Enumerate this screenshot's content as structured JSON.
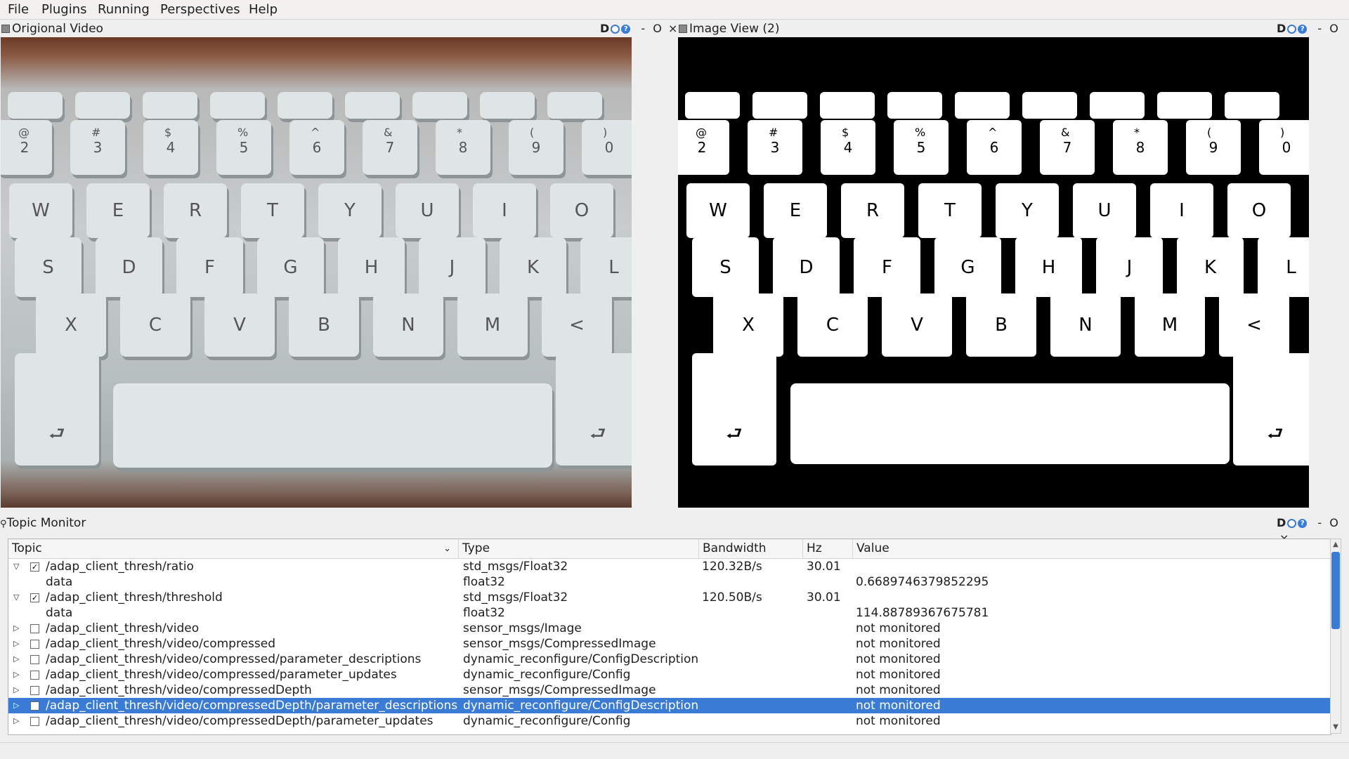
{
  "menubar": {
    "items": [
      {
        "label": "File"
      },
      {
        "label": "Plugins"
      },
      {
        "label": "Running"
      },
      {
        "label": "Perspectives"
      },
      {
        "label": "Help"
      }
    ]
  },
  "docks": {
    "original": {
      "title": "Origional Video"
    },
    "image_view": {
      "title": "Image View (2)"
    },
    "topic_monitor": {
      "title": "Topic Monitor"
    },
    "buttons": {
      "d": "D",
      "minimize": "-",
      "float": "O",
      "close": "×"
    }
  },
  "keyboard": {
    "fn_row": [
      "",
      "",
      "",
      "",
      "",
      "",
      "",
      "",
      ""
    ],
    "num_row": [
      "2",
      "3",
      "4",
      "5",
      "6",
      "7",
      "8",
      "9",
      "0"
    ],
    "num_shift": [
      "@",
      "#",
      "$",
      "%",
      "^",
      "&",
      "*",
      "(",
      ")"
    ],
    "row_q": [
      "W",
      "E",
      "R",
      "T",
      "Y",
      "U",
      "I",
      "O"
    ],
    "row_a": [
      "S",
      "D",
      "F",
      "G",
      "H",
      "J",
      "K",
      "L"
    ],
    "row_z": [
      "X",
      "C",
      "V",
      "B",
      "N",
      "M",
      "<"
    ],
    "return_glyph": "⮐"
  },
  "topic_monitor": {
    "columns": [
      "Topic",
      "Type",
      "Bandwidth",
      "Hz",
      "Value"
    ],
    "rows": [
      {
        "expanded": true,
        "checked": true,
        "topic": "/adap_client_thresh/ratio",
        "type": "std_msgs/Float32",
        "bandwidth": "120.32B/s",
        "hz": "30.01",
        "value": ""
      },
      {
        "child": true,
        "topic": "data",
        "type": "float32",
        "bandwidth": "",
        "hz": "",
        "value": "0.6689746379852295"
      },
      {
        "expanded": true,
        "checked": true,
        "topic": "/adap_client_thresh/threshold",
        "type": "std_msgs/Float32",
        "bandwidth": "120.50B/s",
        "hz": "30.01",
        "value": ""
      },
      {
        "child": true,
        "topic": "data",
        "type": "float32",
        "bandwidth": "",
        "hz": "",
        "value": "114.88789367675781"
      },
      {
        "expanded": false,
        "checked": false,
        "topic": "/adap_client_thresh/video",
        "type": "sensor_msgs/Image",
        "bandwidth": "",
        "hz": "",
        "value": "not monitored"
      },
      {
        "expanded": false,
        "checked": false,
        "topic": "/adap_client_thresh/video/compressed",
        "type": "sensor_msgs/CompressedImage",
        "bandwidth": "",
        "hz": "",
        "value": "not monitored"
      },
      {
        "expanded": false,
        "checked": false,
        "topic": "/adap_client_thresh/video/compressed/parameter_descriptions",
        "type": "dynamic_reconfigure/ConfigDescription",
        "bandwidth": "",
        "hz": "",
        "value": "not monitored"
      },
      {
        "expanded": false,
        "checked": false,
        "topic": "/adap_client_thresh/video/compressed/parameter_updates",
        "type": "dynamic_reconfigure/Config",
        "bandwidth": "",
        "hz": "",
        "value": "not monitored"
      },
      {
        "expanded": false,
        "checked": false,
        "topic": "/adap_client_thresh/video/compressedDepth",
        "type": "sensor_msgs/CompressedImage",
        "bandwidth": "",
        "hz": "",
        "value": "not monitored"
      },
      {
        "expanded": false,
        "checked": false,
        "selected": true,
        "topic": "/adap_client_thresh/video/compressedDepth/parameter_descriptions",
        "type": "dynamic_reconfigure/ConfigDescription",
        "bandwidth": "",
        "hz": "",
        "value": "not monitored"
      },
      {
        "expanded": false,
        "checked": false,
        "topic": "/adap_client_thresh/video/compressedDepth/parameter_updates",
        "type": "dynamic_reconfigure/Config",
        "bandwidth": "",
        "hz": "",
        "value": "not monitored"
      }
    ]
  },
  "colors": {
    "accent": "#3a7bd5",
    "window_bg": "#efefef"
  }
}
